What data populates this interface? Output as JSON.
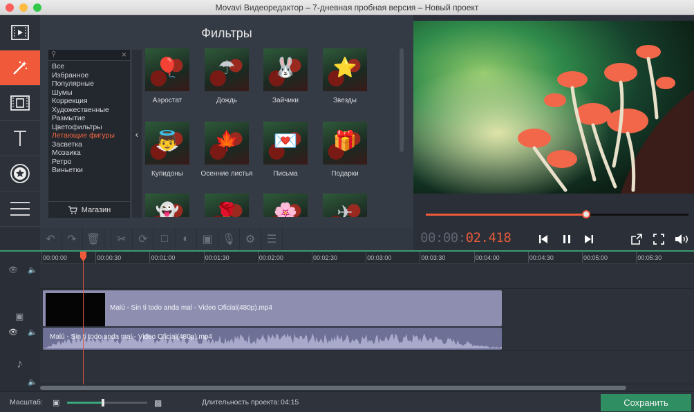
{
  "window": {
    "title": "Movavi Видеоредактор – 7-дневная пробная версия – Новый проект",
    "colors": {
      "close": "#fc605c",
      "minimize": "#fdbc40",
      "zoom": "#34c84a",
      "accent": "#f05a3b",
      "save": "#2f8f62"
    }
  },
  "tools": [
    {
      "name": "import-media",
      "icon": "film-import-icon"
    },
    {
      "name": "filters",
      "icon": "magic-wand-icon",
      "active": true
    },
    {
      "name": "transitions",
      "icon": "transitions-icon"
    },
    {
      "name": "titles",
      "icon": "text-T-icon"
    },
    {
      "name": "stickers",
      "icon": "star-badge-icon"
    },
    {
      "name": "more",
      "icon": "menu-lines-icon"
    }
  ],
  "filters": {
    "heading": "Фильтры",
    "categories": [
      "Все",
      "Избранное",
      "Популярные",
      "Шумы",
      "Коррекция",
      "Художественные",
      "Размытие",
      "Цветофильтры",
      "Летающие фигуры",
      "Засветка",
      "Мозаика",
      "Ретро",
      "Виньетки"
    ],
    "selected_category": "Летающие фигуры",
    "store_label": "Магазин",
    "items": [
      {
        "label": "Аэростат",
        "emoji": "🎈"
      },
      {
        "label": "Дождь",
        "emoji": "☂"
      },
      {
        "label": "Зайчики",
        "emoji": "🐰"
      },
      {
        "label": "Звезды",
        "emoji": "⭐"
      },
      {
        "label": "Купидоны",
        "emoji": "👼"
      },
      {
        "label": "Осенние листья",
        "emoji": "🍁"
      },
      {
        "label": "Письма",
        "emoji": "💌"
      },
      {
        "label": "Подарки",
        "emoji": "🎁"
      },
      {
        "label": "",
        "emoji": "👻"
      },
      {
        "label": "",
        "emoji": "🌹"
      },
      {
        "label": "",
        "emoji": "🌸"
      },
      {
        "label": "",
        "emoji": "✈"
      }
    ]
  },
  "player": {
    "timecode_static": "00:00:",
    "timecode_live": "02.418",
    "seek_fraction": 0.61
  },
  "timeline": {
    "ruler": [
      "00:00:00",
      "00:00:30",
      "00:01:00",
      "00:01:30",
      "00:02:00",
      "00:02:30",
      "00:03:00",
      "00:03:30",
      "00:04:00",
      "00:04:30",
      "00:05:00",
      "00:05:30"
    ],
    "video_clip": "Malú - Sin ti todo anda mal - Video Oficial(480p).mp4",
    "audio_clip": "Malú - Sin ti todo anda mal - Video Oficial(480p).mp4"
  },
  "footer": {
    "scale_label": "Масштаб:",
    "zoom_fraction": 0.45,
    "duration_label": "Длительность проекта:",
    "duration_value": "04:15",
    "save_label": "Сохранить"
  }
}
